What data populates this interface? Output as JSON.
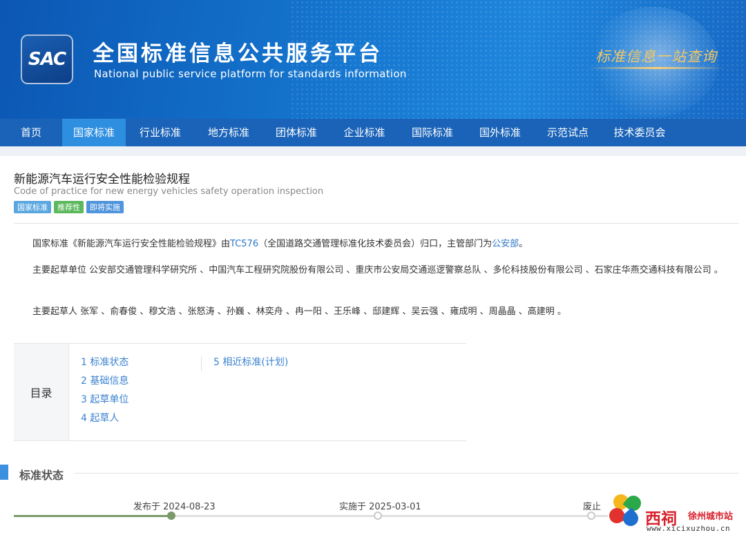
{
  "header": {
    "logo_text": "SAC",
    "title": "全国标准信息公共服务平台",
    "subtitle": "National public service platform  for standards information",
    "slogan": "标准信息一站查询"
  },
  "nav": {
    "items": [
      {
        "label": "首页",
        "active": false
      },
      {
        "label": "国家标准",
        "active": true
      },
      {
        "label": "行业标准",
        "active": false
      },
      {
        "label": "地方标准",
        "active": false
      },
      {
        "label": "团体标准",
        "active": false
      },
      {
        "label": "企业标准",
        "active": false
      },
      {
        "label": "国际标准",
        "active": false
      },
      {
        "label": "国外标准",
        "active": false
      },
      {
        "label": "示范试点",
        "active": false
      },
      {
        "label": "技术委员会",
        "active": false
      }
    ]
  },
  "standard": {
    "title": "新能源汽车运行安全性能检验规程",
    "title_en": "Code of practice for new energy vehicles safety operation inspection",
    "tags": [
      "国家标准",
      "推荐性",
      "即将实施"
    ],
    "intro": {
      "prefix": "国家标准《新能源汽车运行安全性能检验规程》由",
      "tc_link": "TC576",
      "middle": "（全国道路交通管理标准化技术委员会）归口，主管部门为",
      "dept_link": "公安部",
      "suffix": "。"
    },
    "drafting_units": "主要起草单位 公安部交通管理科学研究所 、中国汽车工程研究院股份有限公司 、重庆市公安局交通巡逻警察总队 、多伦科技股份有限公司 、石家庄华燕交通科技有限公司 。",
    "drafters": "主要起草人 张军 、俞春俊 、穆文浩 、张怒涛 、孙巍 、林奕舟 、冉一阳 、王乐峰 、邸建辉 、吴云强 、雍成明 、周晶晶 、高建明 。"
  },
  "toc": {
    "label": "目录",
    "col1": [
      "1  标准状态",
      "2  基础信息",
      "3  起草单位",
      "4  起草人"
    ],
    "col2": [
      "5  相近标准(计划)"
    ]
  },
  "status_section": {
    "title": "标准状态",
    "timeline": [
      {
        "label": "发布于 2024-08-23",
        "done": true
      },
      {
        "label": "实施于 2025-03-01",
        "done": false
      },
      {
        "label": "废止",
        "done": false
      }
    ]
  },
  "watermark": {
    "brand": "西祠",
    "city": "徐州城市站",
    "url": "www.xicixuzhou.cn"
  },
  "colors": {
    "header_blue": "#1576cf",
    "nav_blue": "#1a63b8",
    "nav_active": "#2e8fe0",
    "link": "#2a77c9",
    "timeline_done": "#7a9a6a"
  }
}
